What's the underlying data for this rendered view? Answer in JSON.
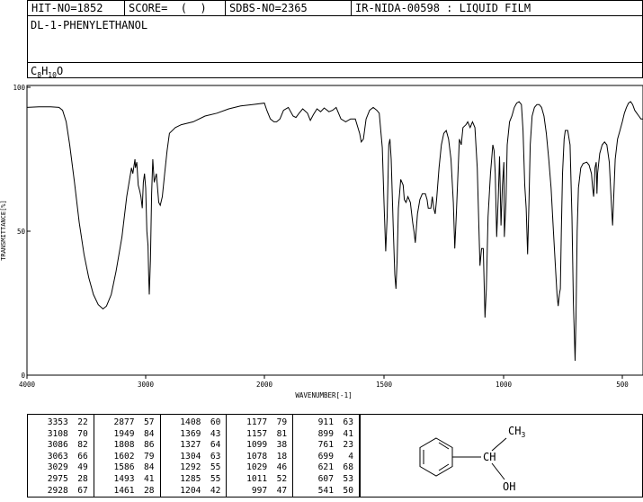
{
  "header": {
    "hit_no": "HIT-NO=1852",
    "score": "SCORE=  (  )",
    "sdbs_no": "SDBS-NO=2365",
    "ir_id": "IR-NIDA-00598 : LIQUID FILM"
  },
  "compound": {
    "name": "DL-1-PHENYLETHANOL",
    "formula_c": "C",
    "formula_c_count": "8",
    "formula_h": "H",
    "formula_h_count": "10",
    "formula_o": "O"
  },
  "chart_data": {
    "type": "line",
    "xlabel": "WAVENUMBER[-1]",
    "ylabel": "TRANSMITTANCE[%]",
    "xlim": [
      4000,
      400
    ],
    "ylim": [
      0,
      100
    ],
    "x_ticks": [
      "4000",
      "3000",
      "2000",
      "1500",
      "1000",
      "500"
    ],
    "y_ticks": [
      "100",
      "50",
      "0"
    ],
    "series": [
      {
        "points": [
          [
            4000,
            93
          ],
          [
            3900,
            93.2
          ],
          [
            3800,
            93.2
          ],
          [
            3730,
            93
          ],
          [
            3700,
            92
          ],
          [
            3670,
            88
          ],
          [
            3640,
            80
          ],
          [
            3600,
            67
          ],
          [
            3560,
            53
          ],
          [
            3520,
            42
          ],
          [
            3480,
            34
          ],
          [
            3440,
            28
          ],
          [
            3400,
            24.5
          ],
          [
            3360,
            23
          ],
          [
            3330,
            24
          ],
          [
            3290,
            28
          ],
          [
            3250,
            36
          ],
          [
            3200,
            48
          ],
          [
            3160,
            62
          ],
          [
            3120,
            72
          ],
          [
            3108,
            70
          ],
          [
            3090,
            75
          ],
          [
            3086,
            72
          ],
          [
            3075,
            74
          ],
          [
            3063,
            66
          ],
          [
            3050,
            64
          ],
          [
            3040,
            62
          ],
          [
            3029,
            58
          ],
          [
            3020,
            67
          ],
          [
            3010,
            70
          ],
          [
            3000,
            65
          ],
          [
            2990,
            50
          ],
          [
            2980,
            45
          ],
          [
            2975,
            35
          ],
          [
            2970,
            28
          ],
          [
            2960,
            40
          ],
          [
            2950,
            63
          ],
          [
            2940,
            75
          ],
          [
            2928,
            67
          ],
          [
            2910,
            70
          ],
          [
            2890,
            60
          ],
          [
            2877,
            59
          ],
          [
            2860,
            62
          ],
          [
            2840,
            70
          ],
          [
            2820,
            78
          ],
          [
            2800,
            84
          ],
          [
            2750,
            86
          ],
          [
            2700,
            87
          ],
          [
            2600,
            88
          ],
          [
            2500,
            90
          ],
          [
            2400,
            91
          ],
          [
            2300,
            92.5
          ],
          [
            2200,
            93.5
          ],
          [
            2100,
            94
          ],
          [
            2000,
            94.5
          ],
          [
            1990,
            92
          ],
          [
            1975,
            89
          ],
          [
            1960,
            88
          ],
          [
            1949,
            88
          ],
          [
            1935,
            89
          ],
          [
            1920,
            92
          ],
          [
            1900,
            93
          ],
          [
            1880,
            90
          ],
          [
            1868,
            89.5
          ],
          [
            1855,
            91
          ],
          [
            1840,
            92.5
          ],
          [
            1820,
            91
          ],
          [
            1808,
            88.5
          ],
          [
            1795,
            90.5
          ],
          [
            1780,
            92.5
          ],
          [
            1765,
            91.5
          ],
          [
            1750,
            92.8
          ],
          [
            1730,
            91.5
          ],
          [
            1715,
            92
          ],
          [
            1700,
            93
          ],
          [
            1680,
            89
          ],
          [
            1660,
            88
          ],
          [
            1640,
            89
          ],
          [
            1620,
            89
          ],
          [
            1602,
            84
          ],
          [
            1595,
            81
          ],
          [
            1586,
            82
          ],
          [
            1575,
            89
          ],
          [
            1560,
            92
          ],
          [
            1545,
            93
          ],
          [
            1530,
            92
          ],
          [
            1520,
            91
          ],
          [
            1507,
            79
          ],
          [
            1500,
            60
          ],
          [
            1493,
            43
          ],
          [
            1487,
            55
          ],
          [
            1480,
            80
          ],
          [
            1475,
            82
          ],
          [
            1470,
            75
          ],
          [
            1461,
            50
          ],
          [
            1455,
            35
          ],
          [
            1450,
            30
          ],
          [
            1445,
            40
          ],
          [
            1440,
            58
          ],
          [
            1430,
            68
          ],
          [
            1420,
            66
          ],
          [
            1415,
            61
          ],
          [
            1408,
            60
          ],
          [
            1400,
            62
          ],
          [
            1390,
            60
          ],
          [
            1380,
            53
          ],
          [
            1375,
            50
          ],
          [
            1369,
            46
          ],
          [
            1360,
            56
          ],
          [
            1350,
            61
          ],
          [
            1340,
            63
          ],
          [
            1327,
            63
          ],
          [
            1320,
            61
          ],
          [
            1315,
            58
          ],
          [
            1304,
            58
          ],
          [
            1298,
            62
          ],
          [
            1292,
            58
          ],
          [
            1286,
            56
          ],
          [
            1280,
            61
          ],
          [
            1270,
            72
          ],
          [
            1260,
            80
          ],
          [
            1250,
            84
          ],
          [
            1240,
            85
          ],
          [
            1230,
            82
          ],
          [
            1220,
            75
          ],
          [
            1210,
            60
          ],
          [
            1204,
            44
          ],
          [
            1198,
            55
          ],
          [
            1190,
            72
          ],
          [
            1185,
            82
          ],
          [
            1177,
            80
          ],
          [
            1170,
            86
          ],
          [
            1157,
            87
          ],
          [
            1150,
            88
          ],
          [
            1140,
            86
          ],
          [
            1130,
            88
          ],
          [
            1120,
            86
          ],
          [
            1110,
            72
          ],
          [
            1099,
            38
          ],
          [
            1092,
            44
          ],
          [
            1085,
            44
          ],
          [
            1078,
            20
          ],
          [
            1072,
            30
          ],
          [
            1065,
            55
          ],
          [
            1055,
            70
          ],
          [
            1045,
            80
          ],
          [
            1040,
            78
          ],
          [
            1035,
            70
          ],
          [
            1029,
            48
          ],
          [
            1022,
            62
          ],
          [
            1017,
            76
          ],
          [
            1011,
            52
          ],
          [
            1005,
            66
          ],
          [
            999,
            74
          ],
          [
            997,
            48
          ],
          [
            990,
            60
          ],
          [
            985,
            80
          ],
          [
            975,
            88
          ],
          [
            965,
            90
          ],
          [
            955,
            93
          ],
          [
            945,
            94.5
          ],
          [
            935,
            95
          ],
          [
            925,
            94
          ],
          [
            918,
            85
          ],
          [
            911,
            66
          ],
          [
            905,
            58
          ],
          [
            899,
            42
          ],
          [
            893,
            60
          ],
          [
            888,
            80
          ],
          [
            880,
            90
          ],
          [
            870,
            93
          ],
          [
            860,
            94
          ],
          [
            850,
            94
          ],
          [
            840,
            93
          ],
          [
            830,
            90
          ],
          [
            820,
            84
          ],
          [
            810,
            75
          ],
          [
            800,
            65
          ],
          [
            790,
            50
          ],
          [
            780,
            35
          ],
          [
            775,
            28
          ],
          [
            770,
            24
          ],
          [
            765,
            28
          ],
          [
            761,
            30
          ],
          [
            757,
            50
          ],
          [
            752,
            70
          ],
          [
            745,
            82
          ],
          [
            740,
            85
          ],
          [
            730,
            85
          ],
          [
            720,
            80
          ],
          [
            712,
            55
          ],
          [
            706,
            25
          ],
          [
            699,
            5
          ],
          [
            695,
            20
          ],
          [
            690,
            50
          ],
          [
            685,
            65
          ],
          [
            675,
            72
          ],
          [
            665,
            73.5
          ],
          [
            650,
            74
          ],
          [
            640,
            73
          ],
          [
            630,
            70
          ],
          [
            625,
            65
          ],
          [
            621,
            62
          ],
          [
            618,
            66
          ],
          [
            615,
            72
          ],
          [
            610,
            74
          ],
          [
            607,
            63
          ],
          [
            604,
            70
          ],
          [
            595,
            77
          ],
          [
            585,
            80
          ],
          [
            575,
            81
          ],
          [
            565,
            80
          ],
          [
            555,
            74
          ],
          [
            545,
            58
          ],
          [
            541,
            52
          ],
          [
            537,
            60
          ],
          [
            530,
            75
          ],
          [
            520,
            82
          ],
          [
            510,
            85
          ],
          [
            500,
            88
          ],
          [
            490,
            91
          ],
          [
            480,
            93
          ],
          [
            470,
            94.5
          ],
          [
            460,
            95
          ],
          [
            450,
            94
          ],
          [
            440,
            92
          ],
          [
            430,
            91
          ],
          [
            420,
            90
          ],
          [
            410,
            89
          ],
          [
            400,
            89
          ]
        ]
      }
    ]
  },
  "peaks": [
    [
      [
        "3353",
        "22"
      ],
      [
        "3108",
        "70"
      ],
      [
        "3086",
        "82"
      ],
      [
        "3063",
        "66"
      ],
      [
        "3029",
        "49"
      ],
      [
        "2975",
        "28"
      ],
      [
        "2928",
        "67"
      ]
    ],
    [
      [
        "2877",
        "57"
      ],
      [
        "1949",
        "84"
      ],
      [
        "1808",
        "86"
      ],
      [
        "1602",
        "79"
      ],
      [
        "1586",
        "84"
      ],
      [
        "1493",
        "41"
      ],
      [
        "1461",
        "28"
      ]
    ],
    [
      [
        "1408",
        "60"
      ],
      [
        "1369",
        "43"
      ],
      [
        "1327",
        "64"
      ],
      [
        "1304",
        "63"
      ],
      [
        "1292",
        "55"
      ],
      [
        "1285",
        "55"
      ],
      [
        "1204",
        "42"
      ]
    ],
    [
      [
        "1177",
        "79"
      ],
      [
        "1157",
        "81"
      ],
      [
        "1099",
        "38"
      ],
      [
        "1078",
        "18"
      ],
      [
        "1029",
        "46"
      ],
      [
        "1011",
        "52"
      ],
      [
        "997",
        "47"
      ]
    ],
    [
      [
        "911",
        "63"
      ],
      [
        "899",
        "41"
      ],
      [
        "761",
        "23"
      ],
      [
        "699",
        "4"
      ],
      [
        "621",
        "68"
      ],
      [
        "607",
        "53"
      ],
      [
        "541",
        "50"
      ]
    ]
  ],
  "structure": {
    "ch3_c": "CH",
    "ch3_sub": "3",
    "ch": "CH",
    "oh": "OH"
  }
}
